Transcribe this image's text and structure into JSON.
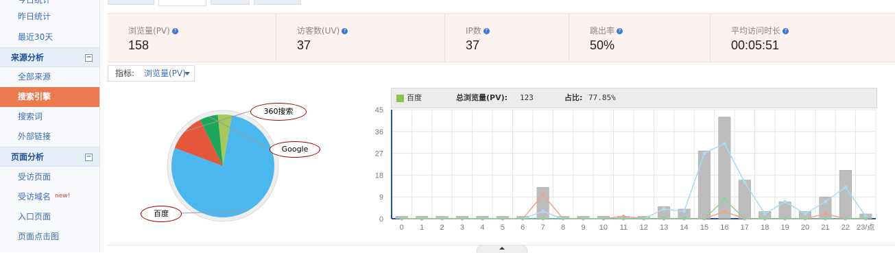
{
  "sidebar": {
    "items": [
      {
        "label": "今日统计",
        "top": -14
      },
      {
        "label": "昨日统计"
      },
      {
        "label": "最近30天"
      }
    ],
    "source_section": {
      "title": "来源分析",
      "toggle": "⊟"
    },
    "source_items": [
      "全部来源",
      "搜索引擎",
      "搜索词",
      "外部链接"
    ],
    "page_section": {
      "title": "页面分析",
      "toggle": "⊟"
    },
    "page_items": [
      "受访页面",
      "受访域名",
      "入口页面",
      "页面点击图"
    ],
    "new_badge": "new!"
  },
  "stats": [
    {
      "label": "浏览量(PV)",
      "value": "158"
    },
    {
      "label": "访客数(UV)",
      "value": "37"
    },
    {
      "label": "IP数",
      "value": "37"
    },
    {
      "label": "跳出率",
      "value": "50%"
    },
    {
      "label": "平均访问时长",
      "value": "00:05:51"
    }
  ],
  "metric_selector": {
    "label": "指标:",
    "value": "浏览量(PV)"
  },
  "pie": {
    "slices": [
      {
        "name": "百度",
        "value": 123,
        "color": "#4ab8ef"
      },
      {
        "name": "360搜索",
        "value": 19,
        "color": "#e5573a"
      },
      {
        "name": "Google",
        "value": 9,
        "color": "#1ba85b"
      },
      {
        "name": "",
        "value": 7,
        "color": "#a6c85a"
      }
    ]
  },
  "legend": {
    "series": "百度",
    "total_label": "总浏览量(PV):",
    "total_value": "123",
    "share_label": "占比:",
    "share_value": "77.85%",
    "color": "#8cc34b"
  },
  "chart_data": {
    "type": "bar",
    "categories": [
      "0",
      "1",
      "2",
      "3",
      "4",
      "5",
      "6",
      "7",
      "8",
      "9",
      "10",
      "11",
      "12",
      "13",
      "14",
      "15",
      "16",
      "17",
      "18",
      "19",
      "20",
      "21",
      "22",
      "23/点"
    ],
    "ylim": [
      0,
      45
    ],
    "yticks": [
      "0",
      "9",
      "18",
      "27",
      "36",
      "45"
    ],
    "series": [
      {
        "values": [
          1,
          1,
          1,
          1,
          1,
          1,
          1,
          13,
          1,
          1,
          1,
          1,
          1,
          5,
          4,
          28,
          42,
          16,
          3,
          7,
          3,
          9,
          20,
          2
        ],
        "color": "#bdbdbd"
      },
      {
        "values": [
          0,
          0,
          0,
          0,
          0,
          0,
          0,
          3,
          0,
          0,
          0,
          0,
          0,
          4,
          3,
          27,
          31,
          15,
          2,
          7,
          2,
          7,
          13,
          1
        ],
        "color": "#a8dcf2"
      },
      {
        "values": [
          0,
          0,
          0,
          0,
          0,
          0,
          0,
          10,
          0,
          0,
          0,
          1,
          0,
          0,
          0,
          0,
          3,
          0,
          0,
          0,
          0,
          2,
          0,
          0
        ],
        "color": "#f2a08a"
      },
      {
        "values": [
          0,
          0,
          0,
          0,
          0,
          0,
          0,
          0,
          0,
          0,
          0,
          0,
          0,
          0,
          0,
          0,
          8,
          0,
          0,
          0,
          0,
          0,
          0,
          0
        ],
        "color": "#8fd19e"
      }
    ]
  }
}
